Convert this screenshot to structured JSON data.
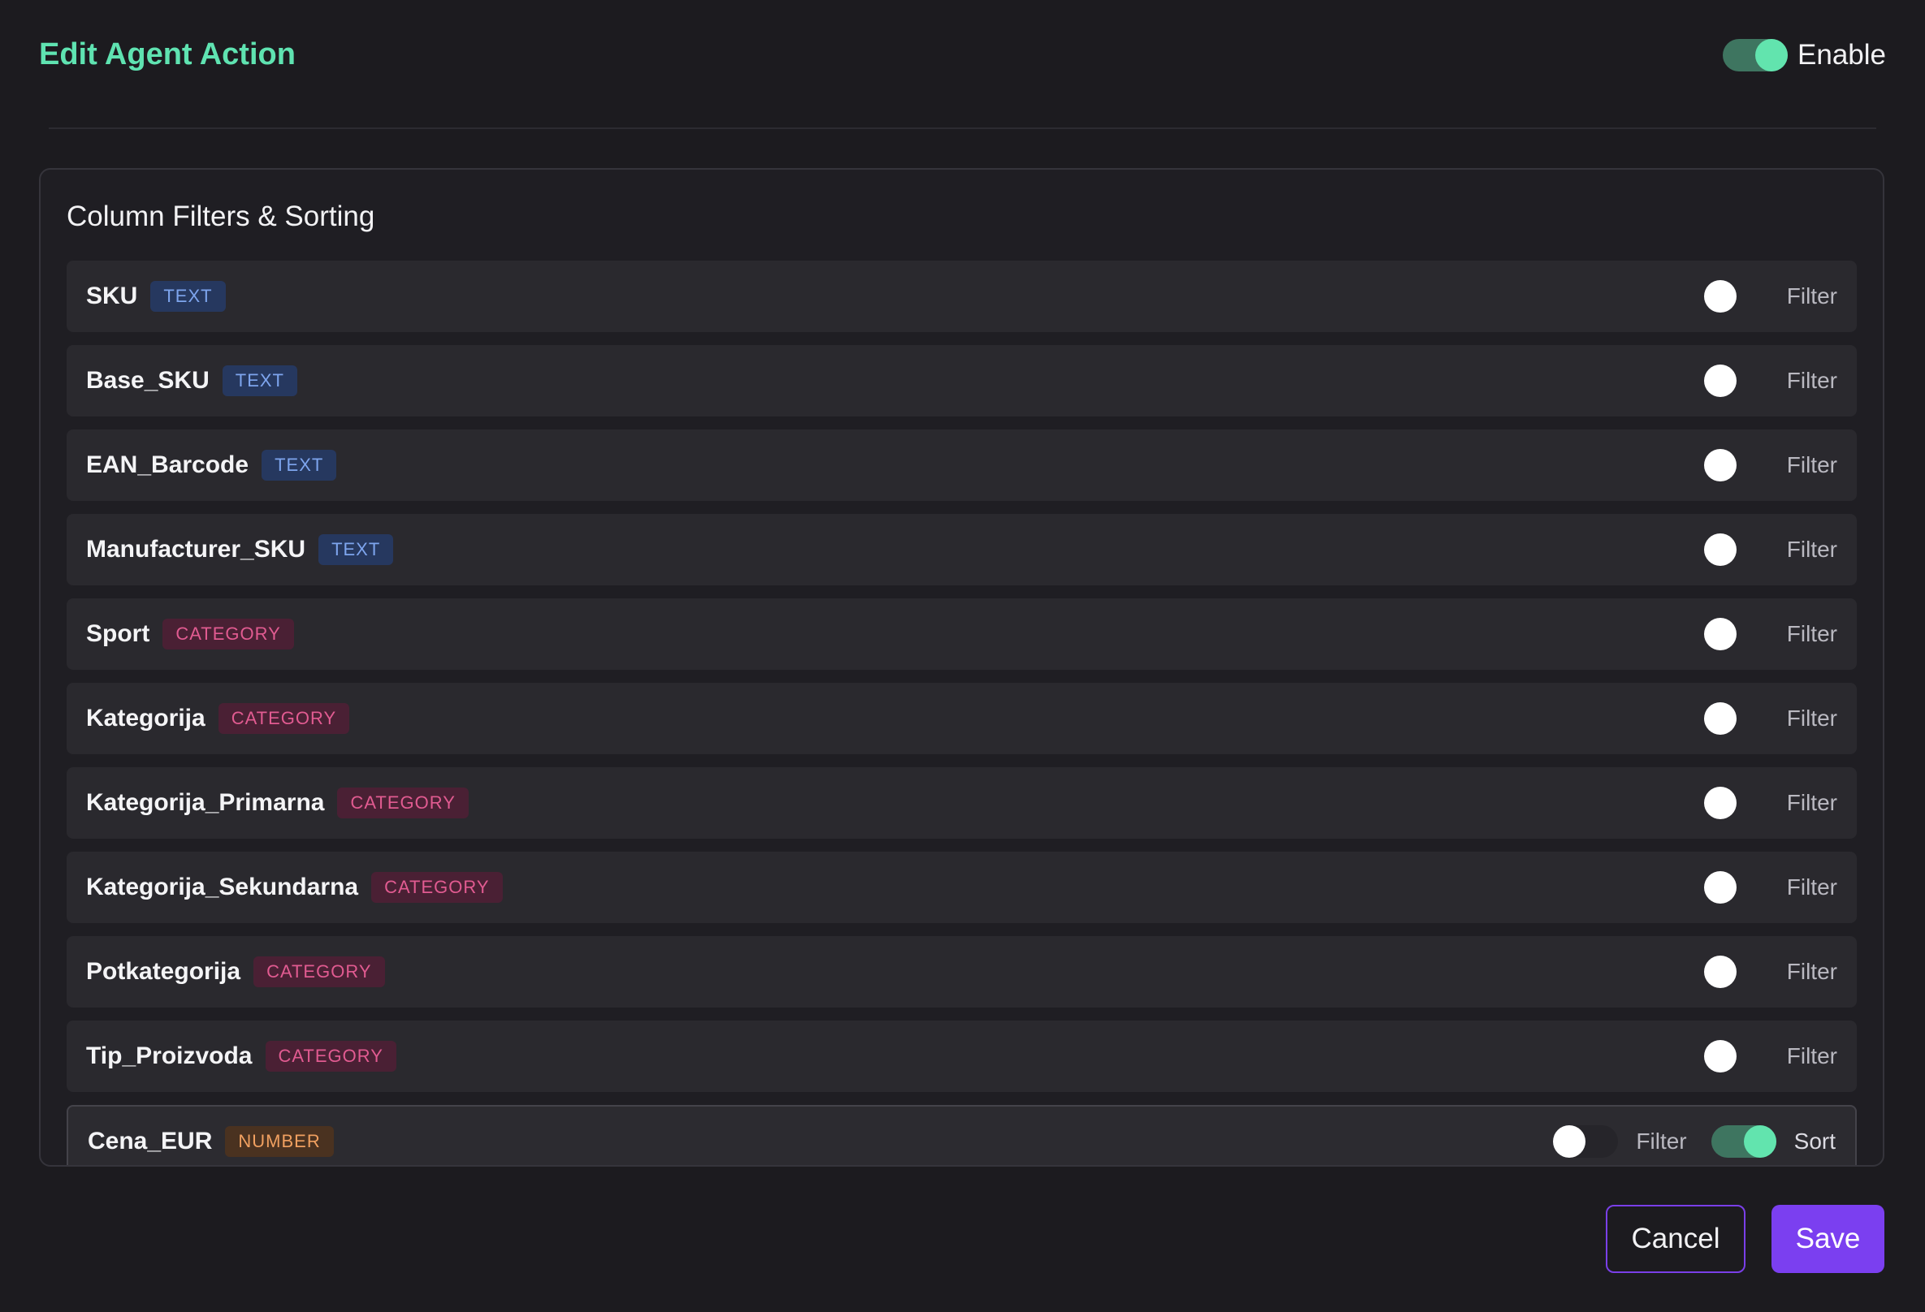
{
  "header": {
    "title": "Edit Agent Action",
    "enable_label": "Enable",
    "enabled": true
  },
  "panel": {
    "title": "Column Filters & Sorting"
  },
  "rows": [
    {
      "name": "SKU",
      "type": "TEXT",
      "filter_label": "Filter",
      "filter_on": false
    },
    {
      "name": "Base_SKU",
      "type": "TEXT",
      "filter_label": "Filter",
      "filter_on": false
    },
    {
      "name": "EAN_Barcode",
      "type": "TEXT",
      "filter_label": "Filter",
      "filter_on": false
    },
    {
      "name": "Manufacturer_SKU",
      "type": "TEXT",
      "filter_label": "Filter",
      "filter_on": false
    },
    {
      "name": "Sport",
      "type": "CATEGORY",
      "filter_label": "Filter",
      "filter_on": false
    },
    {
      "name": "Kategorija",
      "type": "CATEGORY",
      "filter_label": "Filter",
      "filter_on": false
    },
    {
      "name": "Kategorija_Primarna",
      "type": "CATEGORY",
      "filter_label": "Filter",
      "filter_on": false
    },
    {
      "name": "Kategorija_Sekundarna",
      "type": "CATEGORY",
      "filter_label": "Filter",
      "filter_on": false
    },
    {
      "name": "Potkategorija",
      "type": "CATEGORY",
      "filter_label": "Filter",
      "filter_on": false
    },
    {
      "name": "Tip_Proizvoda",
      "type": "CATEGORY",
      "filter_label": "Filter",
      "filter_on": false
    },
    {
      "name": "Cena_EUR",
      "type": "NUMBER",
      "filter_label": "Filter",
      "filter_on": false,
      "sort_label": "Sort",
      "sort_on": true
    }
  ],
  "footer": {
    "cancel_label": "Cancel",
    "save_label": "Save"
  },
  "colors": {
    "accent_green": "#5fe3b1",
    "accent_purple": "#7b3ff0",
    "text_badge": "#7ea5ee",
    "category_badge": "#e15b91",
    "number_badge": "#f0a060"
  }
}
